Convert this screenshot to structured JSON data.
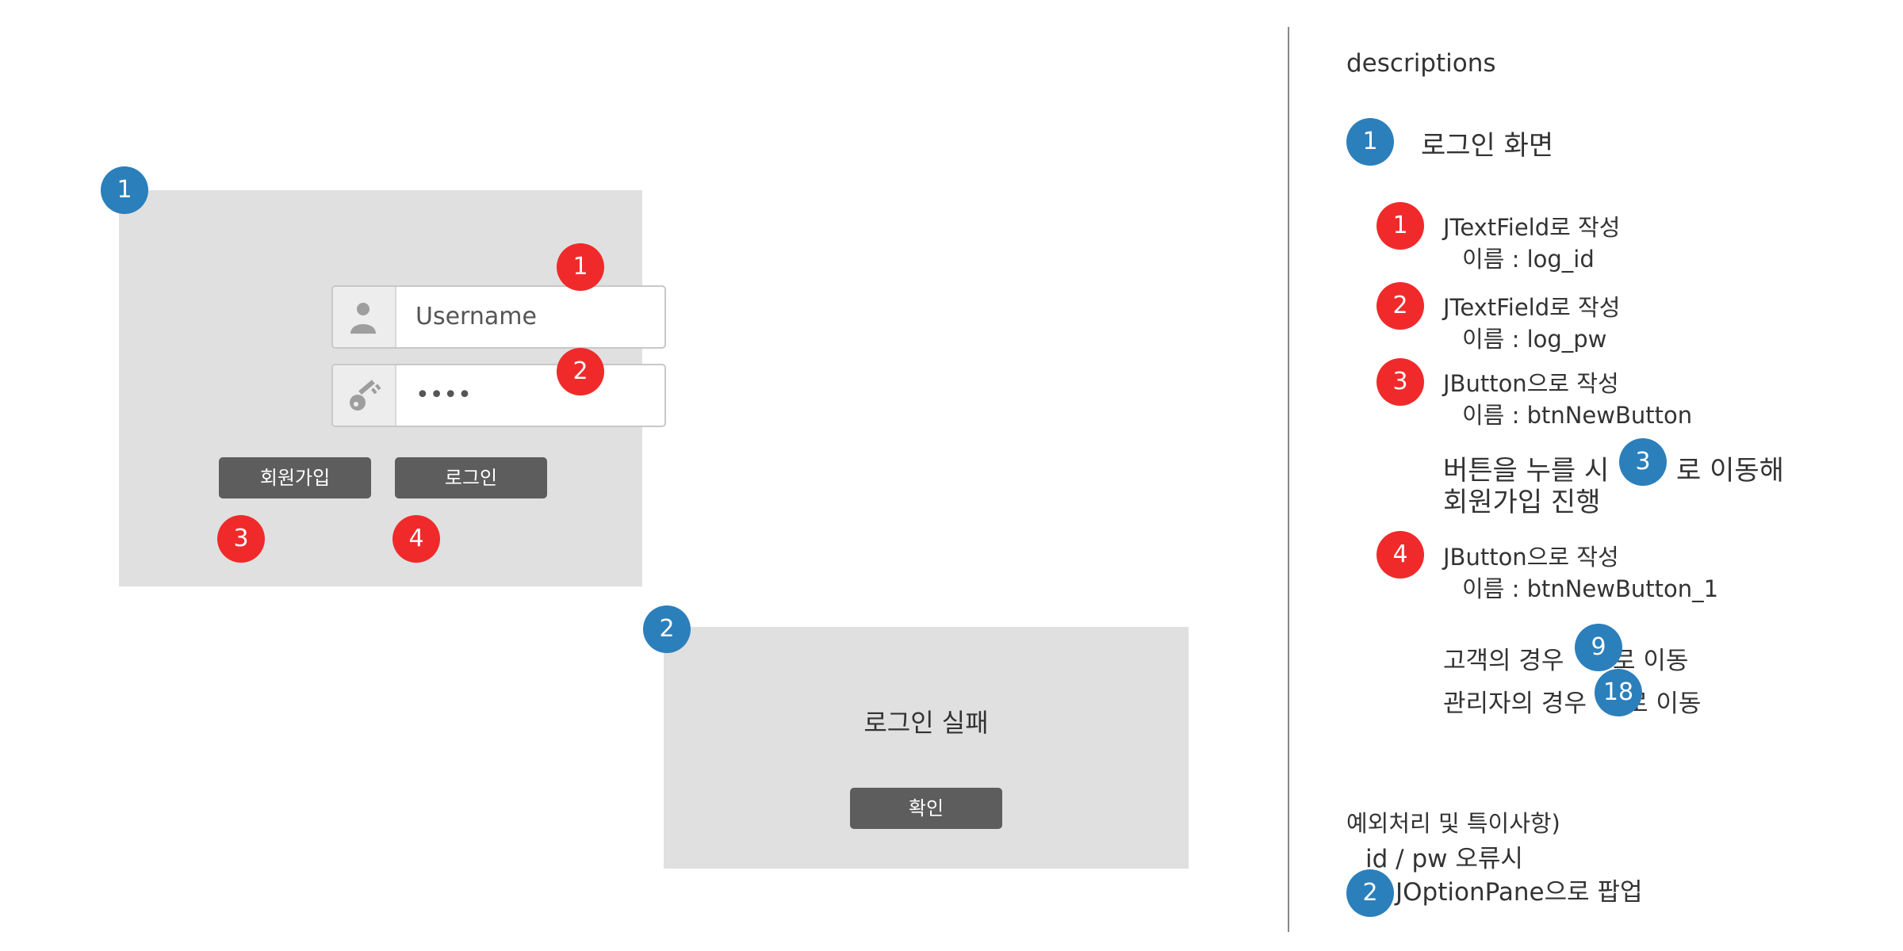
{
  "login_screen": {
    "badge": "1",
    "username_placeholder": "Username",
    "password_value": "••••",
    "signup_button": "회원가입",
    "login_button": "로그인",
    "markers": [
      "1",
      "2",
      "3",
      "4"
    ]
  },
  "failure_dialog": {
    "badge": "2",
    "message": "로그인 실패",
    "confirm_button": "확인"
  },
  "descriptions": {
    "heading": "descriptions",
    "screen_badge": "1",
    "screen_title": "로그인 화면",
    "items": [
      {
        "num": "1",
        "line1": "JTextField로 작성",
        "line2": "이름 : log_id"
      },
      {
        "num": "2",
        "line1": "JTextField로 작성",
        "line2": "이름 : log_pw"
      },
      {
        "num": "3",
        "line1": "JButton으로 작성",
        "line2": "이름 : btnNewButton"
      },
      {
        "num": "4",
        "line1": "JButton으로 작성",
        "line2": "이름 : btnNewButton_1"
      }
    ],
    "signup_note": {
      "prefix": "버튼을 누를 시",
      "badge": "3",
      "suffix": "로 이동해",
      "line2": "회원가입 진행"
    },
    "customer_note": {
      "prefix": "고객의 경우",
      "badge": "9",
      "suffix": "로 이동"
    },
    "admin_note": {
      "prefix": "관리자의 경우",
      "badge": "18",
      "suffix": "로 이동"
    },
    "exceptions": {
      "title": "예외처리 및 특이사항)",
      "line1": "id / pw 오류시",
      "badge": "2",
      "line2": "JOptionPane으로 팝업"
    }
  },
  "colors": {
    "blue_badge": "#2b7fbb",
    "red_badge": "#f02a2a",
    "panel": "#e0e0e0",
    "button": "#5d5d5d"
  }
}
